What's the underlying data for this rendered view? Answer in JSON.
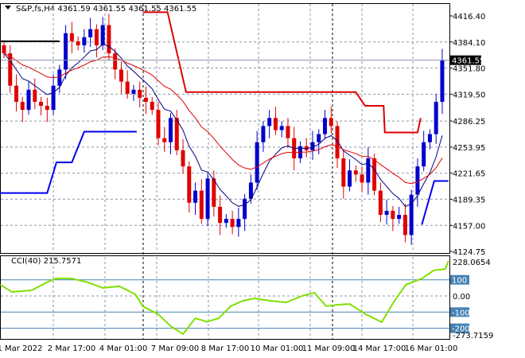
{
  "header": {
    "symbol": "S&P,fs,H4",
    "open": "4361.59",
    "high": "4361.55",
    "low": "4361.55",
    "close": "4361.55"
  },
  "current_price": "4361.55",
  "cci_label": "CCI(40) 215.7571",
  "colors": {
    "bull": "#0000cc",
    "bear": "#e00000",
    "ma_fast": "#000080",
    "ma_slow": "#e00000",
    "cci": "#7fe000",
    "level": "#4682b4"
  },
  "chart_data": {
    "type": "candlestick",
    "price_ticks": [
      "4416.40",
      "4384.10",
      "4351.80",
      "4319.50",
      "4286.25",
      "4253.95",
      "4221.65",
      "4189.35",
      "4157.00",
      "4124.75"
    ],
    "ylim": [
      4124.75,
      4416.4
    ],
    "x_labels": [
      "1 Mar 2022",
      "2 Mar 17:00",
      "4 Mar 01:00",
      "7 Mar 09:00",
      "8 Mar 17:00",
      "10 Mar 01:00",
      "11 Mar 09:00",
      "14 Mar 17:00",
      "16 Mar 01:00"
    ],
    "closes": [
      4370,
      4330,
      4310,
      4300,
      4325,
      4310,
      4305,
      4300,
      4330,
      4350,
      4395,
      4385,
      4380,
      4390,
      4400,
      4380,
      4405,
      4370,
      4350,
      4335,
      4320,
      4325,
      4315,
      4310,
      4300,
      4265,
      4260,
      4290,
      4250,
      4230,
      4185,
      4200,
      4165,
      4215,
      4180,
      4160,
      4165,
      4155,
      4165,
      4190,
      4210,
      4260,
      4280,
      4290,
      4275,
      4280,
      4265,
      4240,
      4255,
      4250,
      4260,
      4270,
      4290,
      4280,
      4240,
      4205,
      4225,
      4220,
      4210,
      4240,
      4200,
      4170,
      4175,
      4165,
      4170,
      4145,
      4195,
      4230,
      4260,
      4270,
      4310,
      4361.55
    ],
    "red_step": [
      [
        22.5,
        4421
      ],
      [
        26.5,
        4421
      ],
      [
        29.5,
        4322
      ],
      [
        57,
        4322
      ],
      [
        58.5,
        4305
      ],
      [
        61.5,
        4305
      ],
      [
        61.7,
        4272
      ],
      [
        67,
        4272
      ],
      [
        67.5,
        4290
      ]
    ],
    "blue_step": [
      [
        -1,
        4197
      ],
      [
        7,
        4197
      ],
      [
        8.5,
        4235
      ],
      [
        11,
        4235
      ],
      [
        13,
        4273
      ],
      [
        21.5,
        4273
      ]
    ],
    "blue_step2": [
      [
        67.7,
        4158
      ],
      [
        69.7,
        4212
      ],
      [
        72,
        4212
      ]
    ],
    "black_line": [
      [
        -1,
        4385
      ],
      [
        9,
        4385
      ]
    ],
    "cci": {
      "label": "CCI(40)",
      "value": 215.7571,
      "max_label": "228.0654",
      "min_label": "-273.7159",
      "levels": [
        "100",
        "0.00",
        "-100",
        "-200"
      ],
      "points": [
        [
          -0.6,
          70
        ],
        [
          1.3,
          25
        ],
        [
          4.5,
          35
        ],
        [
          7,
          85
        ],
        [
          8.4,
          108
        ],
        [
          11,
          108
        ],
        [
          13.5,
          85
        ],
        [
          16,
          50
        ],
        [
          18.7,
          60
        ],
        [
          21.3,
          10
        ],
        [
          22.5,
          -65
        ],
        [
          25,
          -113
        ],
        [
          27,
          -187
        ],
        [
          29,
          -236
        ],
        [
          31,
          -138
        ],
        [
          32.9,
          -160
        ],
        [
          34.8,
          -138
        ],
        [
          36.7,
          -64
        ],
        [
          38.7,
          -30
        ],
        [
          40.6,
          -15
        ],
        [
          43.2,
          -30
        ],
        [
          45.7,
          -40
        ],
        [
          48.3,
          0
        ],
        [
          50.3,
          20
        ],
        [
          52.2,
          -64
        ],
        [
          54.1,
          -54
        ],
        [
          56,
          -50
        ],
        [
          58.6,
          -113
        ],
        [
          61.2,
          -162
        ],
        [
          63.1,
          -40
        ],
        [
          65.1,
          69
        ],
        [
          67.7,
          108
        ],
        [
          69.6,
          158
        ],
        [
          71.5,
          167
        ],
        [
          72,
          215.76
        ]
      ]
    }
  }
}
